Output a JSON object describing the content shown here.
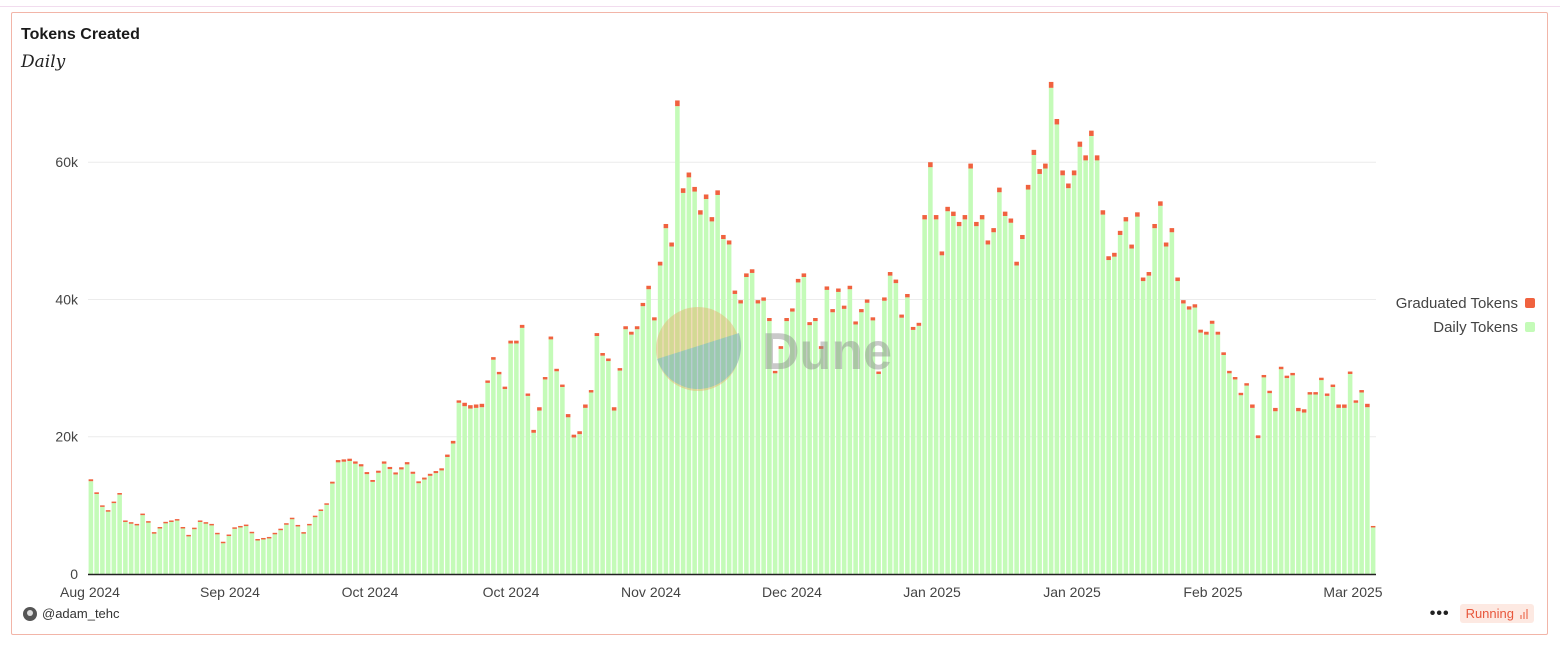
{
  "chart_data": {
    "type": "bar",
    "stacked": true,
    "title": "Tokens Created",
    "subtitle": "Daily",
    "xlabel": "",
    "ylabel": "",
    "ylim": [
      0,
      73000
    ],
    "y_ticks": [
      0,
      20000,
      40000,
      60000
    ],
    "y_tick_labels": [
      "0",
      "20k",
      "40k",
      "60k"
    ],
    "x_tick_labels": [
      "Aug 2024",
      "Sep 2024",
      "Oct 2024",
      "Oct 2024",
      "Nov 2024",
      "Dec 2024",
      "Jan 2025",
      "Jan 2025",
      "Feb 2025",
      "Mar 2025"
    ],
    "grid": true,
    "legend_position": "right",
    "colors": {
      "graduated": "#f0623f",
      "daily": "#c4fbb8"
    },
    "anchors": [
      [
        0,
        13800
      ],
      [
        2,
        10000
      ],
      [
        3,
        9300
      ],
      [
        5,
        11800
      ],
      [
        6,
        7800
      ],
      [
        8,
        7300
      ],
      [
        9,
        8800
      ],
      [
        10,
        7700
      ],
      [
        11,
        6100
      ],
      [
        13,
        7600
      ],
      [
        15,
        8000
      ],
      [
        17,
        5700
      ],
      [
        19,
        7800
      ],
      [
        21,
        7300
      ],
      [
        23,
        4700
      ],
      [
        25,
        6800
      ],
      [
        27,
        7200
      ],
      [
        29,
        5100
      ],
      [
        31,
        5400
      ],
      [
        33,
        6600
      ],
      [
        35,
        8200
      ],
      [
        37,
        6100
      ],
      [
        39,
        8500
      ],
      [
        41,
        10300
      ],
      [
        43,
        16600
      ],
      [
        45,
        16800
      ],
      [
        47,
        16000
      ],
      [
        49,
        13700
      ],
      [
        51,
        16400
      ],
      [
        53,
        14800
      ],
      [
        55,
        16300
      ],
      [
        57,
        13500
      ],
      [
        59,
        14600
      ],
      [
        61,
        15400
      ],
      [
        63,
        19400
      ],
      [
        64,
        25300
      ],
      [
        66,
        24600
      ],
      [
        68,
        24800
      ],
      [
        70,
        31600
      ],
      [
        72,
        27300
      ],
      [
        73,
        34000
      ],
      [
        74,
        34000
      ],
      [
        75,
        36300
      ],
      [
        76,
        26300
      ],
      [
        77,
        21000
      ],
      [
        78,
        24300
      ],
      [
        79,
        28700
      ],
      [
        80,
        34600
      ],
      [
        81,
        29900
      ],
      [
        82,
        27600
      ],
      [
        83,
        23300
      ],
      [
        84,
        20300
      ],
      [
        85,
        20800
      ],
      [
        86,
        24700
      ],
      [
        87,
        26800
      ],
      [
        88,
        35100
      ],
      [
        89,
        32200
      ],
      [
        90,
        31400
      ],
      [
        91,
        24300
      ],
      [
        92,
        30000
      ],
      [
        93,
        36100
      ],
      [
        94,
        35300
      ],
      [
        95,
        36100
      ],
      [
        96,
        39500
      ],
      [
        97,
        42000
      ],
      [
        98,
        37400
      ],
      [
        99,
        45500
      ],
      [
        100,
        51000
      ],
      [
        101,
        48300
      ],
      [
        102,
        69000
      ],
      [
        103,
        56200
      ],
      [
        104,
        58500
      ],
      [
        105,
        56400
      ],
      [
        106,
        53000
      ],
      [
        107,
        55300
      ],
      [
        108,
        52000
      ],
      [
        109,
        55900
      ],
      [
        110,
        49400
      ],
      [
        111,
        48600
      ],
      [
        112,
        41300
      ],
      [
        113,
        39900
      ],
      [
        114,
        43800
      ],
      [
        115,
        44400
      ],
      [
        116,
        39900
      ],
      [
        117,
        40300
      ],
      [
        118,
        37300
      ],
      [
        119,
        29600
      ],
      [
        120,
        33200
      ],
      [
        121,
        37300
      ],
      [
        122,
        38700
      ],
      [
        123,
        43000
      ],
      [
        124,
        43800
      ],
      [
        125,
        36700
      ],
      [
        126,
        37300
      ],
      [
        127,
        33200
      ],
      [
        128,
        41900
      ],
      [
        129,
        38600
      ],
      [
        130,
        41600
      ],
      [
        131,
        39100
      ],
      [
        132,
        42000
      ],
      [
        133,
        36800
      ],
      [
        134,
        38600
      ],
      [
        135,
        40000
      ],
      [
        136,
        37400
      ],
      [
        137,
        29500
      ],
      [
        138,
        40300
      ],
      [
        139,
        44000
      ],
      [
        140,
        42900
      ],
      [
        141,
        37800
      ],
      [
        142,
        40800
      ],
      [
        143,
        36000
      ],
      [
        144,
        36600
      ],
      [
        145,
        52300
      ],
      [
        146,
        60000
      ],
      [
        147,
        52300
      ],
      [
        148,
        47000
      ],
      [
        149,
        53500
      ],
      [
        150,
        52800
      ],
      [
        151,
        51300
      ],
      [
        152,
        52300
      ],
      [
        153,
        59800
      ],
      [
        154,
        51300
      ],
      [
        155,
        52300
      ],
      [
        156,
        48600
      ],
      [
        157,
        50400
      ],
      [
        158,
        56300
      ],
      [
        159,
        52800
      ],
      [
        160,
        51800
      ],
      [
        161,
        45500
      ],
      [
        162,
        49400
      ],
      [
        163,
        56700
      ],
      [
        164,
        61800
      ],
      [
        165,
        59000
      ],
      [
        166,
        59800
      ],
      [
        167,
        71700
      ],
      [
        168,
        66300
      ],
      [
        169,
        58800
      ],
      [
        170,
        56900
      ],
      [
        171,
        58800
      ],
      [
        172,
        63000
      ],
      [
        173,
        61000
      ],
      [
        174,
        64600
      ],
      [
        175,
        61000
      ],
      [
        176,
        53000
      ],
      [
        177,
        46300
      ],
      [
        178,
        46800
      ],
      [
        179,
        50000
      ],
      [
        180,
        52000
      ],
      [
        181,
        48000
      ],
      [
        182,
        52700
      ],
      [
        183,
        43200
      ],
      [
        184,
        44000
      ],
      [
        185,
        51000
      ],
      [
        186,
        54300
      ],
      [
        187,
        48300
      ],
      [
        188,
        50400
      ],
      [
        189,
        43200
      ],
      [
        190,
        39900
      ],
      [
        191,
        39000
      ],
      [
        192,
        39300
      ],
      [
        193,
        35600
      ],
      [
        194,
        35300
      ],
      [
        195,
        36900
      ],
      [
        196,
        35300
      ],
      [
        197,
        32300
      ],
      [
        198,
        29600
      ],
      [
        199,
        28700
      ],
      [
        200,
        26400
      ],
      [
        201,
        27800
      ],
      [
        202,
        24700
      ],
      [
        203,
        20200
      ],
      [
        204,
        29000
      ],
      [
        205,
        26700
      ],
      [
        206,
        24200
      ],
      [
        207,
        30200
      ],
      [
        208,
        28900
      ],
      [
        209,
        29300
      ],
      [
        210,
        24200
      ],
      [
        211,
        24000
      ],
      [
        212,
        26500
      ],
      [
        213,
        26500
      ],
      [
        214,
        28600
      ],
      [
        215,
        26300
      ],
      [
        216,
        27600
      ],
      [
        217,
        24700
      ],
      [
        218,
        24700
      ],
      [
        219,
        29500
      ],
      [
        220,
        25300
      ],
      [
        221,
        26800
      ],
      [
        222,
        24800
      ],
      [
        223,
        7000
      ]
    ]
  },
  "author": {
    "handle": "@adam_tehc"
  },
  "status": {
    "label": "Running"
  },
  "more_label": "•••",
  "icons": {
    "more": "more-horizontal-icon",
    "status": "signal-bars-icon",
    "avatar": "avatar-icon",
    "watermark": "dune-logo"
  }
}
